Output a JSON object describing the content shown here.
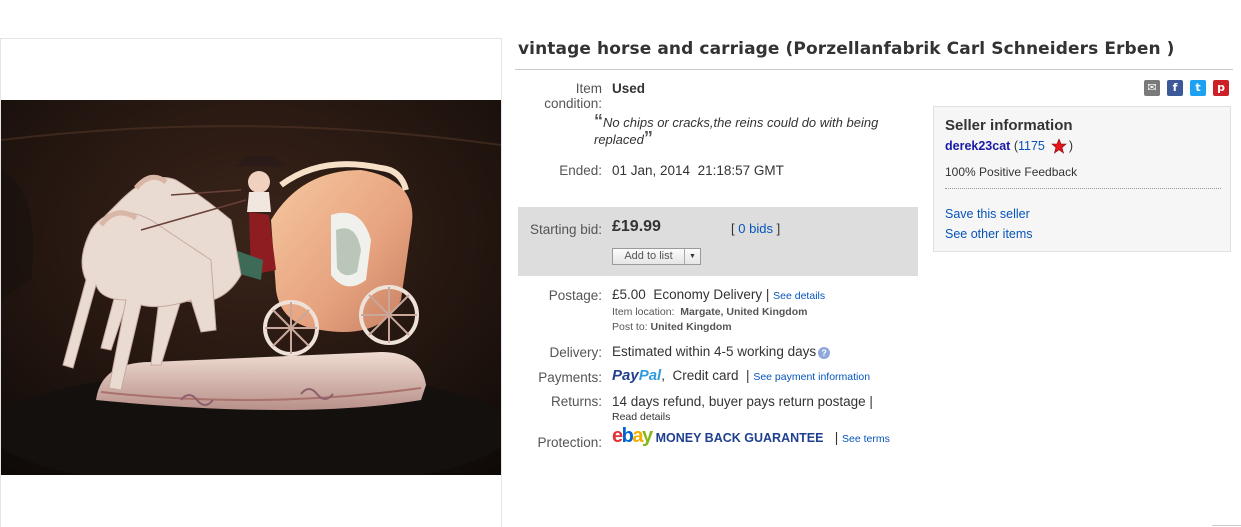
{
  "listing": {
    "title": "vintage horse and carriage (Porzellanfabrik Carl Schneiders Erben )"
  },
  "condition": {
    "label_line1": "Item",
    "label_line2": "condition:",
    "value": "Used",
    "quote_open": "“",
    "quote_text": "No chips or cracks,the reins could do with being replaced",
    "quote_close": "”"
  },
  "ended": {
    "label": "Ended:",
    "date": "01 Jan, 2014",
    "time": "21:18:57 GMT"
  },
  "bidding": {
    "label": "Starting bid:",
    "price": "£19.99",
    "bids_open": "[",
    "bids_link": "0 bids",
    "bids_close": "]",
    "add_to_list": "Add to list",
    "dropdown_arrow": "▼"
  },
  "postage": {
    "label": "Postage:",
    "price": "£5.00",
    "service": "Economy Delivery",
    "separator": "|",
    "details_link": "See details",
    "location_label": "Item location:",
    "location_value": "Margate, United Kingdom",
    "post_to_label": "Post to:",
    "post_to_value": "United Kingdom"
  },
  "delivery": {
    "label": "Delivery:",
    "value": "Estimated within 4-5 working days",
    "help_icon": "?"
  },
  "payments": {
    "label": "Payments:",
    "paypal_part1": "Pay",
    "paypal_part2": "Pal",
    "comma": ",",
    "card": "Credit card",
    "separator": "|",
    "info_link": "See payment information"
  },
  "returns": {
    "label": "Returns:",
    "value": "14 days refund, buyer pays return postage |",
    "details_link": "Read details"
  },
  "protection": {
    "label": "Protection:",
    "ebay_letters": [
      "e",
      "b",
      "a",
      "y"
    ],
    "ebay_colors": [
      "#e53238",
      "#0064d2",
      "#f5af02",
      "#86b817"
    ],
    "guarantee": "MONEY BACK GUARANTEE",
    "separator": "|",
    "terms_link": "See terms"
  },
  "share": {
    "email": "✉",
    "facebook": "f",
    "twitter": "t",
    "pinterest": "p",
    "colors": {
      "email": "#7a7a7a",
      "facebook": "#3b5998",
      "twitter": "#1da1f2",
      "pinterest": "#cb2027"
    }
  },
  "seller": {
    "heading": "Seller information",
    "username": "derek23cat",
    "score_open": "(",
    "score": "1175",
    "score_close": ")",
    "feedback": "100% Positive Feedback",
    "save_link": "Save this seller",
    "other_items_link": "See other items"
  }
}
